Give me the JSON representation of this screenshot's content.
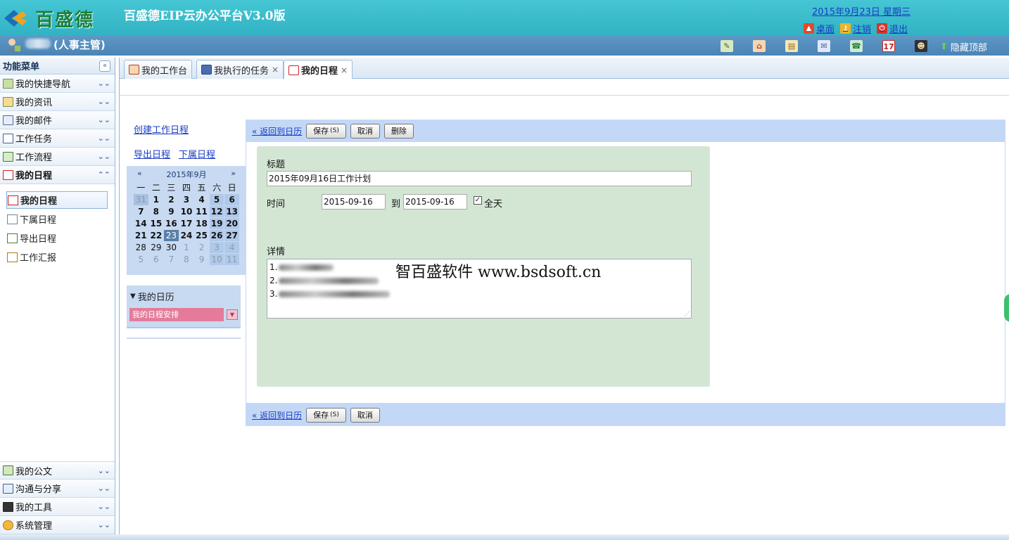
{
  "header": {
    "logo_text": "百盛德",
    "app_title": "百盛德EIP云办公平台V3.0版",
    "date": "2015年9月23日 星期三",
    "links": [
      {
        "label": "桌面",
        "icon": "desktop-icon"
      },
      {
        "label": "注销",
        "icon": "logout-key-icon"
      },
      {
        "label": "退出",
        "icon": "power-icon"
      }
    ]
  },
  "userbar": {
    "role": "(人事主管)",
    "toolbar_icons": [
      "edit-note-icon",
      "home-icon",
      "clipboard-icon",
      "mail-icon",
      "phonebook-icon",
      "calendar-icon",
      "user-avatar-icon"
    ],
    "hide_top": "隐藏顶部"
  },
  "menu": {
    "title": "功能菜单",
    "sections_top": [
      {
        "label": "我的快捷导航",
        "icon": "shortcut-nav-icon"
      },
      {
        "label": "我的资讯",
        "icon": "news-icon"
      },
      {
        "label": "我的邮件",
        "icon": "mail-icon"
      },
      {
        "label": "工作任务",
        "icon": "task-book-icon"
      },
      {
        "label": "工作流程",
        "icon": "workflow-icon"
      },
      {
        "label": "我的日程",
        "icon": "calendar-icon"
      }
    ],
    "schedule_items": [
      {
        "label": "我的日程",
        "icon": "calendar-icon"
      },
      {
        "label": "下属日程",
        "icon": "subordinate-calendar-icon"
      },
      {
        "label": "导出日程",
        "icon": "export-icon"
      },
      {
        "label": "工作汇报",
        "icon": "report-icon"
      }
    ],
    "sections_bottom": [
      {
        "label": "我的公文",
        "icon": "document-icon"
      },
      {
        "label": "沟通与分享",
        "icon": "share-icon"
      },
      {
        "label": "我的工具",
        "icon": "tools-icon"
      },
      {
        "label": "系统管理",
        "icon": "users-admin-icon"
      }
    ]
  },
  "tabs": [
    {
      "label": "我的工作台",
      "icon": "home-icon"
    },
    {
      "label": "我执行的任务",
      "icon": "save-disk-icon"
    },
    {
      "label": "我的日程",
      "icon": "calendar-icon"
    }
  ],
  "side": {
    "create": "创建工作日程",
    "export": "导出日程",
    "subordinate": "下属日程",
    "calendar": {
      "prev": "«",
      "month": "2015年9月",
      "next": "»",
      "weekdays": [
        "一",
        "二",
        "三",
        "四",
        "五",
        "六",
        "日"
      ],
      "weeks": [
        [
          "31",
          "1",
          "2",
          "3",
          "4",
          "5",
          "6"
        ],
        [
          "7",
          "8",
          "9",
          "10",
          "11",
          "12",
          "13"
        ],
        [
          "14",
          "15",
          "16",
          "17",
          "18",
          "19",
          "20"
        ],
        [
          "21",
          "22",
          "23",
          "24",
          "25",
          "26",
          "27"
        ],
        [
          "28",
          "29",
          "30",
          "1",
          "2",
          "3",
          "4"
        ],
        [
          "5",
          "6",
          "7",
          "8",
          "9",
          "10",
          "11"
        ]
      ],
      "today": "23"
    },
    "my_calendar": {
      "title": "我的日历",
      "item": "我的日程安排"
    }
  },
  "form": {
    "back": "« 返回到日历",
    "save": "保存",
    "save_key": "(S)",
    "cancel": "取消",
    "delete": "删除",
    "title_label": "标题",
    "title_value": "2015年09月16日工作计划",
    "time_label": "时间",
    "start": "2015-09-16",
    "to": "到",
    "end": "2015-09-16",
    "allday_checked": true,
    "allday": "全天",
    "details_label": "详情",
    "detail_lines": [
      "1.",
      "2.",
      "3."
    ],
    "watermark": "智百盛软件 www.bsdsoft.cn"
  }
}
